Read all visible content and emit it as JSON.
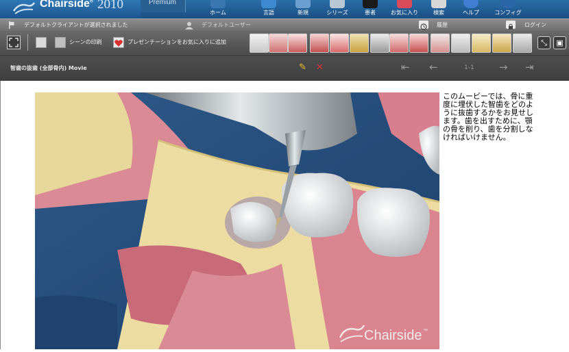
{
  "app": {
    "logo_text": "Chairside",
    "logo_trademark": "®",
    "year": "2010",
    "edition": "Premium"
  },
  "nav": [
    {
      "label": "ホーム",
      "icon": "home-icon"
    },
    {
      "label": "言語",
      "icon": "language-icon"
    },
    {
      "label": "新規",
      "icon": "new-icon"
    },
    {
      "label": "シリーズ",
      "icon": "series-icon"
    },
    {
      "label": "患者",
      "icon": "patient-icon"
    },
    {
      "label": "お気に入り",
      "icon": "favorites-icon"
    },
    {
      "label": "検索",
      "icon": "search-icon"
    },
    {
      "label": "ヘルプ",
      "icon": "help-icon"
    },
    {
      "label": "コンフィグ",
      "icon": "config-icon"
    }
  ],
  "status": {
    "client": "デフォルトクライアントが選択されました",
    "user": "デフォルトユーザー",
    "history": "履歴",
    "login": "ログイン"
  },
  "toolbar": {
    "print_label": "シーンの印刷",
    "favorite_label": "プレゼンテーションをお気に入りに追加",
    "thumbnails": [
      "procedure-thumbnail",
      "procedure-thumbnail",
      "procedure-thumbnail",
      "procedure-thumbnail",
      "procedure-thumbnail",
      "procedure-thumbnail",
      "procedure-thumbnail",
      "procedure-thumbnail",
      "procedure-thumbnail",
      "procedure-thumbnail",
      "procedure-thumbnail",
      "procedure-thumbnail",
      "procedure-thumbnail",
      "procedure-thumbnail",
      "procedure-thumbnail"
    ]
  },
  "titlebar": {
    "title": "智歯の抜歯 (全部骨内) Movie",
    "page": "1-1"
  },
  "content": {
    "description": "このムービーでは、骨に重度に埋伏した智歯をどのように抜歯するかをお見せします。歯を出すために、顎の骨を削り、歯を分割しなければいけません。",
    "watermark": "Chairside",
    "watermark_tm": "™"
  },
  "colors": {
    "nav_blue": "#1f5e96",
    "toolbar_gray": "#5a5a5a",
    "title_gray": "#444444",
    "accent_red": "#e03030",
    "accent_yellow": "#f0c020"
  }
}
